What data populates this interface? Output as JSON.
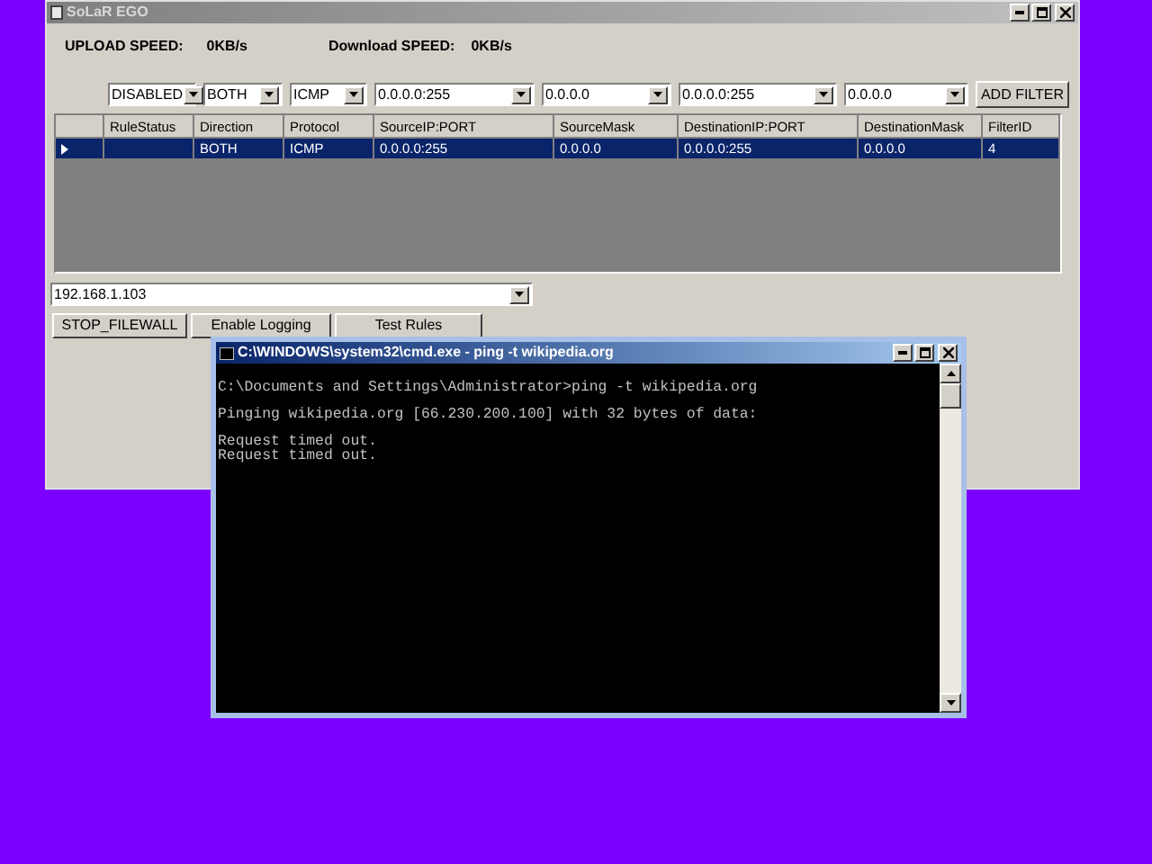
{
  "main_window": {
    "title": "SoLaR EGO",
    "upload_label": "UPLOAD SPEED:",
    "upload_value": "0KB/s",
    "download_label": "Download SPEED:",
    "download_value": "0KB/s",
    "filters": [
      "DISABLED",
      "BOTH",
      "ICMP",
      "0.0.0.0:255",
      "0.0.0.0",
      "0.0.0.0:255",
      "0.0.0.0"
    ],
    "add_filter_button": "ADD FILTER",
    "table": {
      "columns": [
        "RuleStatus",
        "Direction",
        "Protocol",
        "SourceIP:PORT",
        "SourceMask",
        "DestinationIP:PORT",
        "DestinationMask",
        "FilterID"
      ],
      "rows": [
        {
          "selected": true,
          "cells": [
            "",
            "BOTH",
            "ICMP",
            "0.0.0.0:255",
            "0.0.0.0",
            "0.0.0.0:255",
            "0.0.0.0",
            "4"
          ]
        }
      ]
    },
    "address_combo": "192.168.1.103",
    "buttons": [
      "STOP_FILEWALL",
      "Enable Logging",
      "Test Rules"
    ]
  },
  "console_window": {
    "title": "C:\\WINDOWS\\system32\\cmd.exe - ping -t wikipedia.org",
    "blocks": [
      [
        "C:\\Documents and Settings\\Administrator>ping -t wikipedia.org"
      ],
      [
        "Pinging wikipedia.org [66.230.200.100] with 32 bytes of data:"
      ],
      [
        "Request timed out.",
        "Request timed out."
      ]
    ]
  }
}
